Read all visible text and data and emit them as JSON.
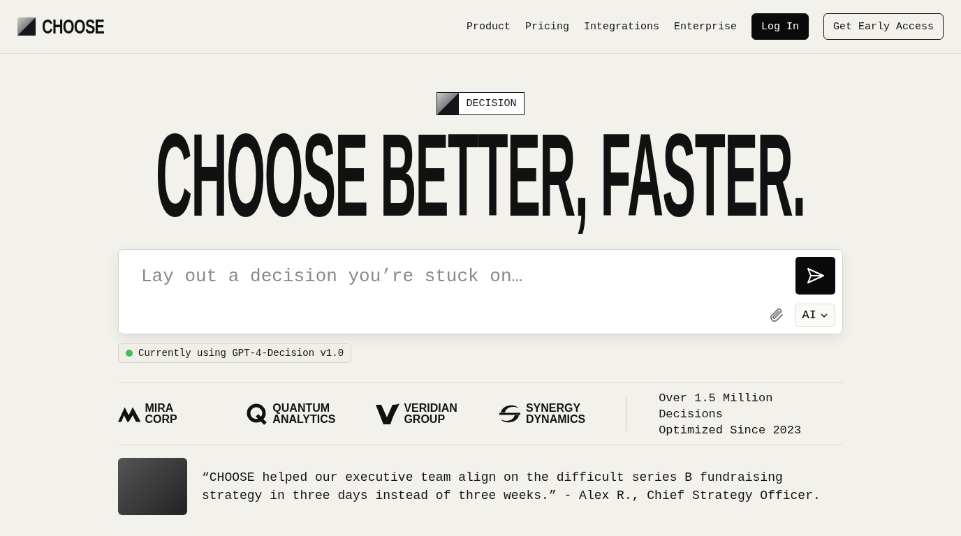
{
  "nav": {
    "brand": "CHOOSE",
    "links": [
      "Product",
      "Pricing",
      "Integrations",
      "Enterprise"
    ],
    "buttons": [
      {
        "label": "Log In",
        "kind": "primary"
      },
      {
        "label": "Get Early Access",
        "kind": "outline"
      }
    ]
  },
  "hero": {
    "badge": "DECISION",
    "headline": "CHOOSE BETTER, FASTER."
  },
  "prompt": {
    "placeholder": "Lay out a decision you’re stuck on…",
    "model_select": "AI"
  },
  "status": {
    "text": "Currently using GPT-4-Decision v1.0",
    "color": "#3fbf5a"
  },
  "logos": [
    {
      "kind": "mira",
      "lines": [
        "MIRA CORP"
      ]
    },
    {
      "kind": "quantum",
      "lines": [
        "QUANTUM",
        "ANALYTICS"
      ]
    },
    {
      "kind": "veridian",
      "lines": [
        "VERIDIAN",
        "GROUP"
      ]
    },
    {
      "kind": "synergy",
      "lines": [
        "SYNERGY",
        "DYNAMICS"
      ]
    }
  ],
  "stat": {
    "lines": [
      "Over 1.5 Million Decisions",
      "Optimized Since 2023"
    ]
  },
  "testimonial": {
    "quote": "“CHOOSE helped our executive team align on the difficult series B fundraising strategy in three days instead of three weeks.” - Alex R., Chief Strategy Officer."
  }
}
